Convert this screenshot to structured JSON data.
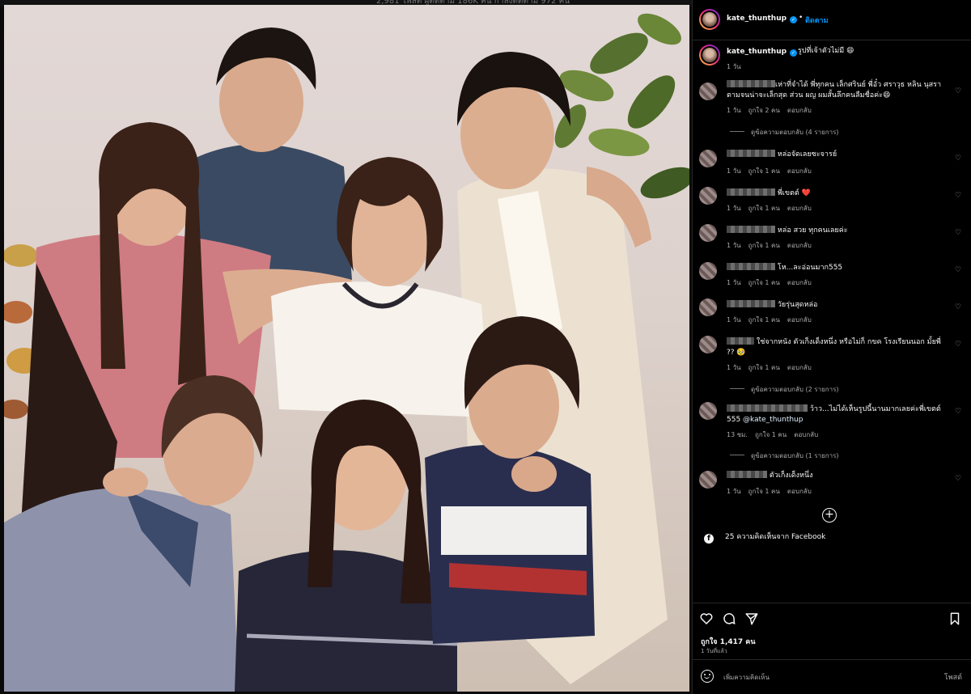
{
  "page_title": "",
  "top_strip_text": "2,981 โพสต์   ผู้ติดตาม 186K คน   กำลังติดตาม 972 คน",
  "photo": {
    "icon": "group-photo"
  },
  "header": {
    "username": "kate_thunthup",
    "follow_label": "ติดตาม",
    "separator": "•"
  },
  "caption": {
    "username": "kate_thunthup",
    "text": "รูปที่เจ้าตัวไม่มี 😄",
    "time": "1 วัน"
  },
  "comments": [
    {
      "text": "เห่าที่จำได้ พี่ทุกคน เล็กศรินย์ พี่อั๋ว ศราวุธ หลิน นุสรา",
      "text2": "ตามจนน่าจะเล็กสุด ส่วน ผญ ผมสั้นลึกคนลืมชื่อค่ะ😄",
      "time": "1 วัน",
      "likes": "ถูกใจ 2 คน",
      "reply": "ตอบกลับ",
      "view_replies": "ดูข้อความตอบกลับ (4 รายการ)"
    },
    {
      "text": "หล่อจัดเลยซะจารย์",
      "time": "1 วัน",
      "likes": "ถูกใจ 1 คน",
      "reply": "ตอบกลับ"
    },
    {
      "text": "พี่เขตต์ ❤️",
      "time": "1 วัน",
      "likes": "ถูกใจ 1 คน",
      "reply": "ตอบกลับ"
    },
    {
      "text": "หล่อ สวย ทุกคนเลยค่ะ",
      "time": "1 วัน",
      "likes": "ถูกใจ 1 คน",
      "reply": "ตอบกลับ"
    },
    {
      "text": "โห...ละอ่อนมาก555",
      "time": "1 วัน",
      "likes": "ถูกใจ 1 คน",
      "reply": "ตอบกลับ"
    },
    {
      "text": "วัยรุ่นสุดหล่อ",
      "time": "1 วัน",
      "likes": "ถูกใจ 1 คน",
      "reply": "ตอบกลับ"
    },
    {
      "text": "ใช่จากหนัง ตัวเก็งเด็งหนึ่ง หรือไม่ก็ กขค โรงเรียนนอก มั้ยพี่",
      "text2": "?? 🥹",
      "time": "1 วัน",
      "likes": "ถูกใจ 1 คน",
      "reply": "ตอบกลับ",
      "view_replies": "ดูข้อความตอบกลับ (2 รายการ)"
    },
    {
      "text": "ว้าว...ไม่ได้เห็นรูปนี้นานมากเลยค่ะพี่เขตต์",
      "text2": "555 ",
      "mention": "@kate_thunthup",
      "time": "13 ชม.",
      "likes": "ถูกใจ 1 คน",
      "reply": "ตอบกลับ",
      "view_replies": "ดูข้อความตอบกลับ (1 รายการ)"
    },
    {
      "text": "ตัวเก็งเด็งหนึ่ง",
      "time": "1 วัน",
      "likes": "ถูกใจ 1 คน",
      "reply": "ตอบกลับ"
    }
  ],
  "facebook_comments": "25 ความคิดเห็นจาก Facebook",
  "likes_total": "ถูกใจ 1,417 คน",
  "posted_ago": "1 วันที่แล้ว",
  "compose": {
    "placeholder": "เพิ่มความคิดเห็น",
    "post_label": "โพสต์"
  },
  "icons": {
    "heart": "heart-icon",
    "comment": "comment-icon",
    "share": "share-icon",
    "save": "bookmark-icon",
    "more_comments": "plus-circle-icon",
    "facebook": "facebook-icon",
    "emoji": "emoji-icon"
  },
  "colors": {
    "link_blue": "#0095f6",
    "background": "#000000",
    "muted": "#a8a8a8"
  }
}
